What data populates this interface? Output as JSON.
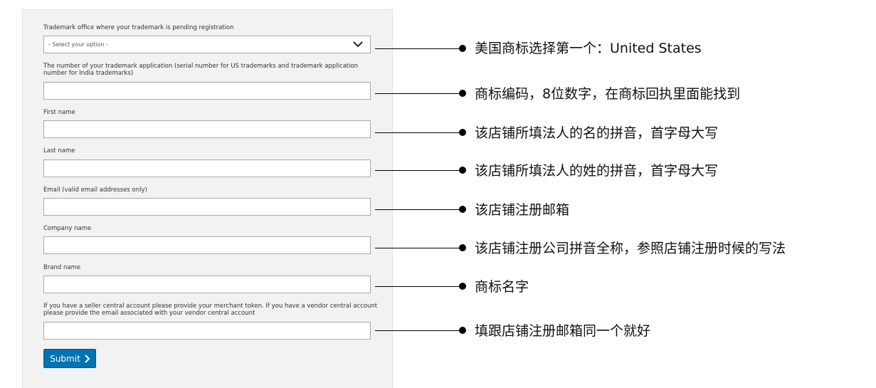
{
  "form": {
    "trademark_office_label": "Trademark office where your trademark is pending registration",
    "trademark_office_selected": "- Select your option -",
    "application_number_label": "The number of your trademark application (serial number for US trademarks and trademark application number for India trademarks)",
    "first_name_label": "First name",
    "last_name_label": "Last name",
    "email_label": "Email (valid email addresses only)",
    "company_label": "Company name",
    "brand_label": "Brand name",
    "merchant_token_label": "If you have a seller central account please provide your merchant token. If you have a vendor central account please provide the email associated with your vendor central account",
    "submit_label": "Submit"
  },
  "annotations": [
    "美国商标选择第一个：United States",
    "商标编码，8位数字，在商标回执里面能找到",
    "该店铺所填法人的名的拼音，首字母大写",
    "该店铺所填法人的姓的拼音，首字母大写",
    "该店铺注册邮箱",
    "该店铺注册公司拼音全称，参照店铺注册时候的写法",
    "商标名字",
    "填跟店铺注册邮箱同一个就好"
  ],
  "icons": {
    "dropdown": "chevron-down-icon",
    "submit": "chevron-right-icon"
  }
}
